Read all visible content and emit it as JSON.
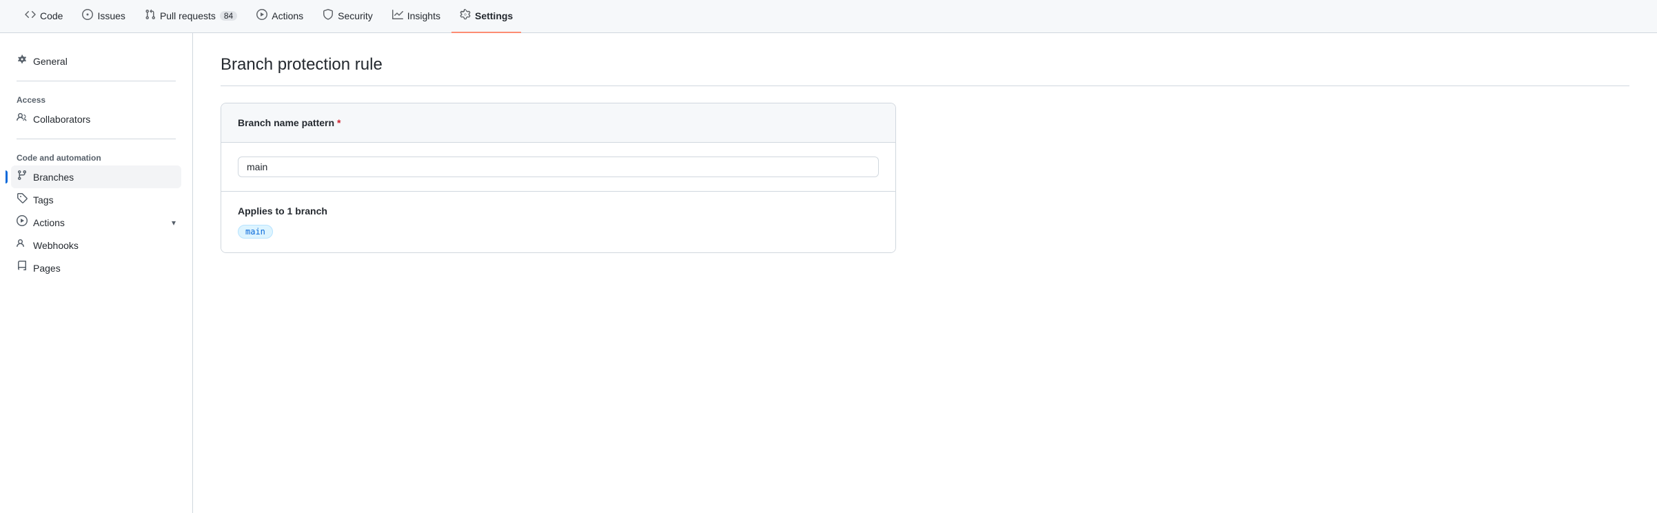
{
  "topnav": {
    "items": [
      {
        "id": "code",
        "label": "Code",
        "icon": "code",
        "badge": null,
        "active": false
      },
      {
        "id": "issues",
        "label": "Issues",
        "icon": "issue",
        "badge": null,
        "active": false
      },
      {
        "id": "pull-requests",
        "label": "Pull requests",
        "icon": "pr",
        "badge": "84",
        "active": false
      },
      {
        "id": "actions",
        "label": "Actions",
        "icon": "play",
        "badge": null,
        "active": false
      },
      {
        "id": "security",
        "label": "Security",
        "icon": "shield",
        "badge": null,
        "active": false
      },
      {
        "id": "insights",
        "label": "Insights",
        "icon": "graph",
        "badge": null,
        "active": false
      },
      {
        "id": "settings",
        "label": "Settings",
        "icon": "gear",
        "badge": null,
        "active": true
      }
    ]
  },
  "sidebar": {
    "general_label": "General",
    "access_section_title": "Access",
    "collaborators_label": "Collaborators",
    "code_section_title": "Code and automation",
    "branches_label": "Branches",
    "tags_label": "Tags",
    "actions_label": "Actions",
    "webhooks_label": "Webhooks",
    "pages_label": "Pages"
  },
  "main": {
    "title": "Branch protection rule",
    "branch_name_pattern_label": "Branch name pattern",
    "required_indicator": "*",
    "branch_input_value": "main",
    "applies_to_label": "Applies to 1 branch",
    "branch_tag": "main"
  }
}
